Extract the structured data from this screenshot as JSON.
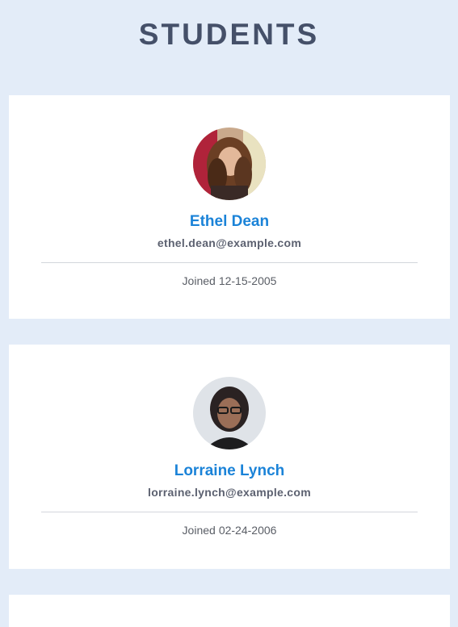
{
  "header": {
    "title": "STUDENTS"
  },
  "students": [
    {
      "name": "Ethel Dean",
      "email": "ethel.dean@example.com",
      "joined_prefix": "Joined",
      "joined_date": "12-15-2005",
      "avatar_icon": "user-photo"
    },
    {
      "name": "Lorraine Lynch",
      "email": "lorraine.lynch@example.com",
      "joined_prefix": "Joined",
      "joined_date": "02-24-2006",
      "avatar_icon": "user-photo"
    }
  ],
  "colors": {
    "background": "#e3ecf8",
    "title": "#455069",
    "name": "#1b83d8",
    "email": "#5c6170",
    "card": "#ffffff"
  }
}
